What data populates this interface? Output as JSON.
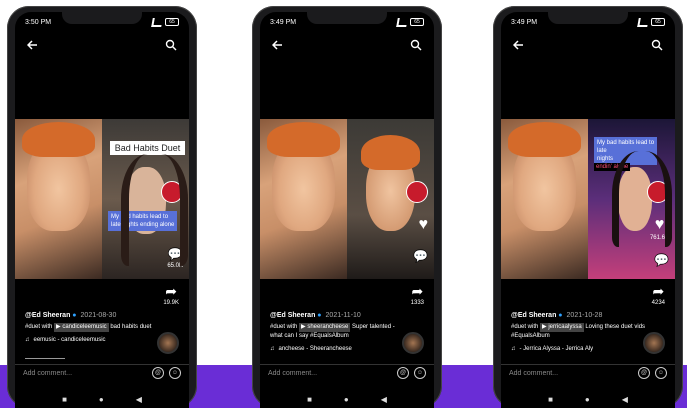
{
  "phones": [
    {
      "time": "3:50 PM",
      "duet_title": "Bad Habits Duet",
      "caption_lines": [
        "My bad habits lead to",
        "late nights ending alone"
      ],
      "pink_caption": "",
      "like_count": "",
      "comment_count": "65.0K",
      "share_count": "19.9K",
      "author": "@Ed Sheeran",
      "date": "2021-08-30",
      "desc_prefix": "#duet with",
      "duet_user": "candiceleemusic",
      "desc_suffix": "bad habits duet",
      "music": "eemusic - candiceleemusic"
    },
    {
      "time": "3:49 PM",
      "duet_title": "",
      "caption_lines": [],
      "pink_caption": "",
      "like_count": "",
      "comment_count": "",
      "share_count": "1333",
      "author": "@Ed Sheeran",
      "date": "2021-11-10",
      "desc_prefix": "#duet with",
      "duet_user": "sheerancheese",
      "desc_suffix": "Super talented - what can I say #EqualsAlbum",
      "music": "ancheese - Sheerancheese"
    },
    {
      "time": "3:49 PM",
      "duet_title": "",
      "caption_lines": [
        "My bad habits lead to",
        "late",
        "nights"
      ],
      "pink_caption": "endin' alone",
      "like_count": "761.6K",
      "comment_count": "",
      "share_count": "4234",
      "author": "@Ed Sheeran",
      "date": "2021-10-28",
      "desc_prefix": "#duet with",
      "duet_user": "jerricaalyssa",
      "desc_suffix": "Loving these duet vids #EqualsAlbum",
      "music": "- Jerrica Alyssa - Jerrica Aly"
    }
  ],
  "comment_placeholder": "Add comment...",
  "accent_colors": {
    "band": "#6a2dd6",
    "line": "#15c7e8",
    "caption_bg": "#5870d8",
    "pink": "#ff4d7a"
  }
}
